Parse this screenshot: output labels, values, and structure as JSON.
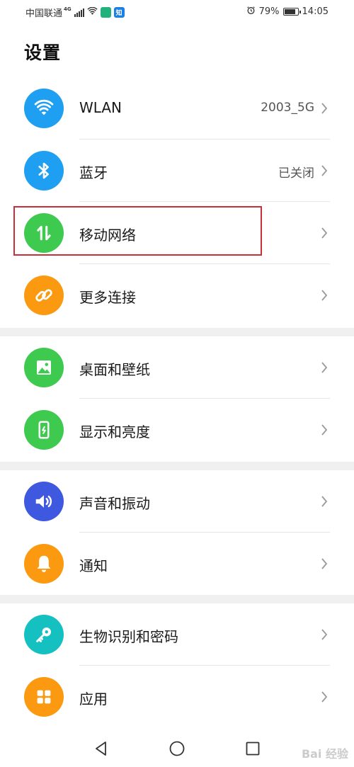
{
  "status_bar": {
    "carrier": "中国联通",
    "network": "4G",
    "app_badge_1": "",
    "app_badge_2": "知",
    "battery": "79%",
    "battery_level": 0.79,
    "time": "14:05"
  },
  "page_title": "设置",
  "groups": [
    {
      "items": [
        {
          "label": "WLAN",
          "value": "2003_5G",
          "icon": "wifi-icon",
          "color": "#1e9ff2"
        },
        {
          "label": "蓝牙",
          "value": "已关闭",
          "icon": "bluetooth-icon",
          "color": "#1e9ff2"
        },
        {
          "label": "移动网络",
          "value": "",
          "icon": "mobile-data-icon",
          "color": "#3ec94f"
        },
        {
          "label": "更多连接",
          "value": "",
          "icon": "link-icon",
          "color": "#fb9a10"
        }
      ]
    },
    {
      "items": [
        {
          "label": "桌面和壁纸",
          "value": "",
          "icon": "wallpaper-icon",
          "color": "#3ec94f"
        },
        {
          "label": "显示和亮度",
          "value": "",
          "icon": "display-icon",
          "color": "#3ec94f"
        }
      ]
    },
    {
      "items": [
        {
          "label": "声音和振动",
          "value": "",
          "icon": "sound-icon",
          "color": "#3e58e0"
        },
        {
          "label": "通知",
          "value": "",
          "icon": "bell-icon",
          "color": "#fb9a10"
        }
      ]
    },
    {
      "items": [
        {
          "label": "生物识别和密码",
          "value": "",
          "icon": "key-icon",
          "color": "#14c0c0"
        },
        {
          "label": "应用",
          "value": "",
          "icon": "apps-icon",
          "color": "#fb9a10"
        }
      ]
    }
  ],
  "nav_bar": {
    "back": "back-icon",
    "home": "home-icon",
    "recents": "recents-icon"
  },
  "watermark": "Bai 经验"
}
